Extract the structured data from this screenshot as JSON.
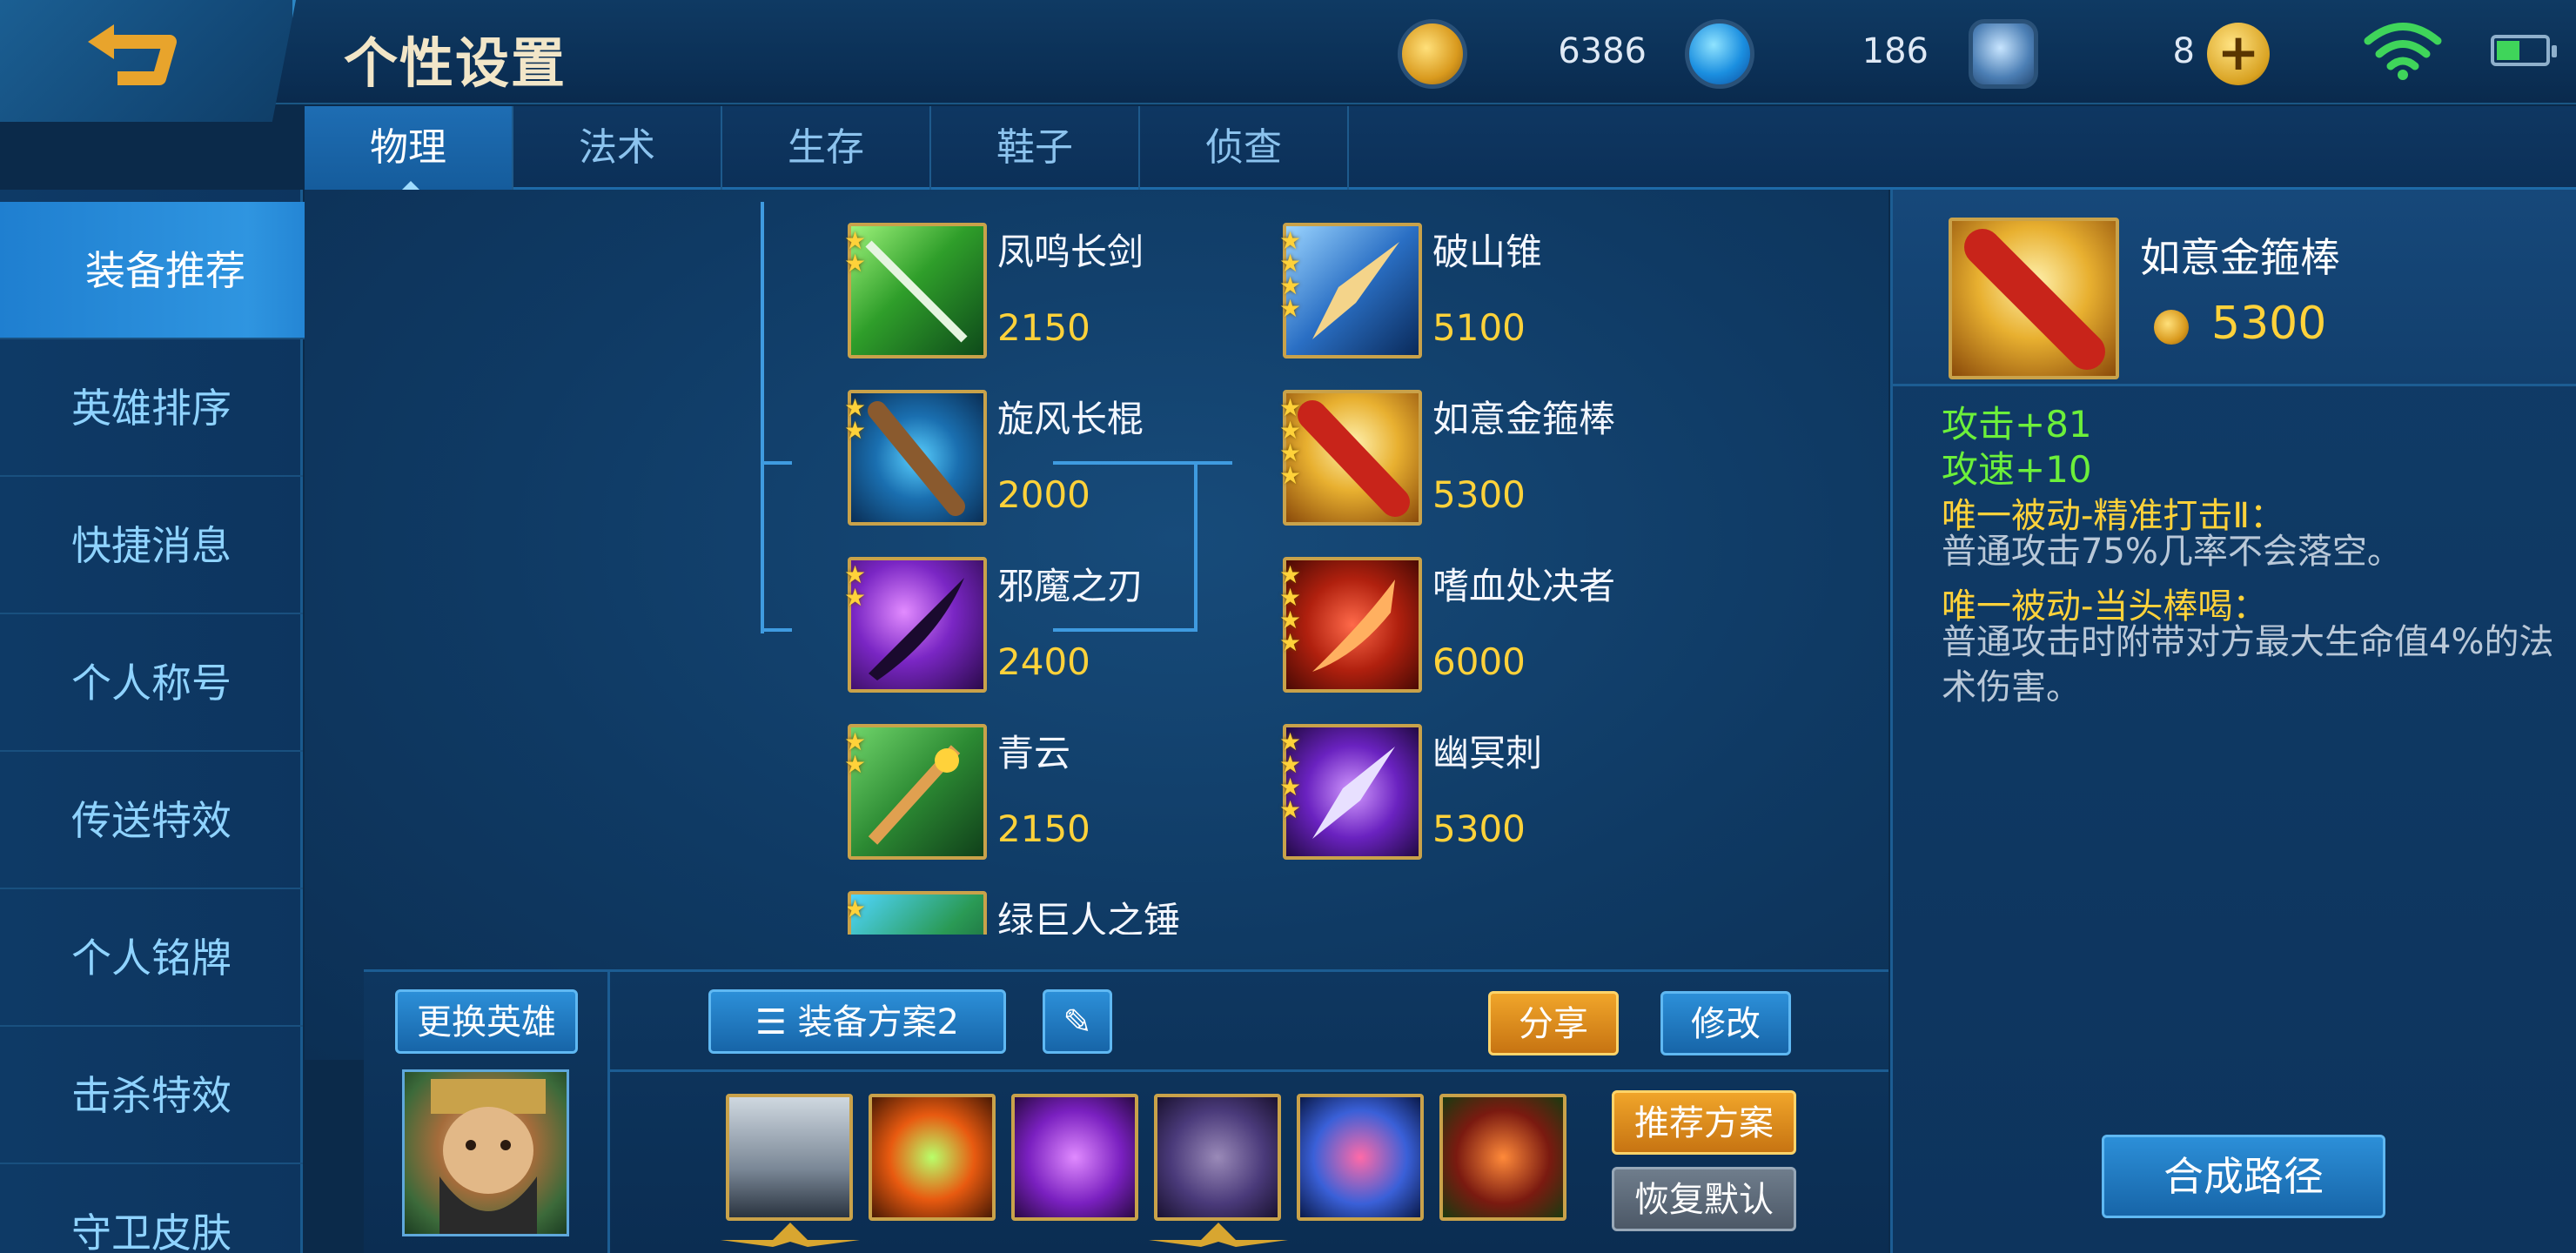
{
  "header": {
    "title": "个性设置",
    "currencies": [
      {
        "name": "gold",
        "amount": "6386"
      },
      {
        "name": "diamond",
        "amount": "186"
      },
      {
        "name": "voucher",
        "amount": "8"
      }
    ],
    "plus_label": "+"
  },
  "tabs": [
    {
      "label": "物理",
      "active": true
    },
    {
      "label": "法术",
      "active": false
    },
    {
      "label": "生存",
      "active": false
    },
    {
      "label": "鞋子",
      "active": false
    },
    {
      "label": "侦查",
      "active": false
    }
  ],
  "sidebar": {
    "items": [
      {
        "label": "装备推荐",
        "active": true
      },
      {
        "label": "英雄排序"
      },
      {
        "label": "快捷消息"
      },
      {
        "label": "个人称号"
      },
      {
        "label": "传送特效"
      },
      {
        "label": "个人铭牌"
      },
      {
        "label": "击杀特效"
      },
      {
        "label": "守卫皮肤"
      }
    ]
  },
  "items": {
    "col1": [
      {
        "name": "凤鸣长剑",
        "price": "2150",
        "stars": 2
      },
      {
        "name": "旋风长棍",
        "price": "2000",
        "stars": 2
      },
      {
        "name": "邪魔之刃",
        "price": "2400",
        "stars": 2
      },
      {
        "name": "青云",
        "price": "2150",
        "stars": 2
      },
      {
        "name": "绿巨人之锤",
        "price": "",
        "stars": 1
      }
    ],
    "col2": [
      {
        "name": "破山锥",
        "price": "5100",
        "stars": 4
      },
      {
        "name": "如意金箍棒",
        "price": "5300",
        "stars": 4
      },
      {
        "name": "嗜血处决者",
        "price": "6000",
        "stars": 4
      },
      {
        "name": "幽冥刺",
        "price": "5300",
        "stars": 4
      }
    ]
  },
  "bottom": {
    "change_hero": "更换英雄",
    "plan_label": "装备方案2",
    "share": "分享",
    "modify": "修改",
    "recommend": "推荐方案",
    "restore": "恢复默认"
  },
  "detail": {
    "name": "如意金箍棒",
    "price": "5300",
    "stat1": "攻击+81",
    "stat2": "攻速+10",
    "passive1_title": "唯一被动-精准打击Ⅱ：",
    "passive1_desc": "普通攻击75%几率不会落空。",
    "passive2_title": "唯一被动-当头棒喝：",
    "passive2_desc": "普通攻击时附带对方最大生命值4%的法术伤害。",
    "compose": "合成路径"
  },
  "colors": {
    "accent_blue": "#2c8fd8",
    "gold": "#ffd23a",
    "green": "#6cf03a"
  }
}
